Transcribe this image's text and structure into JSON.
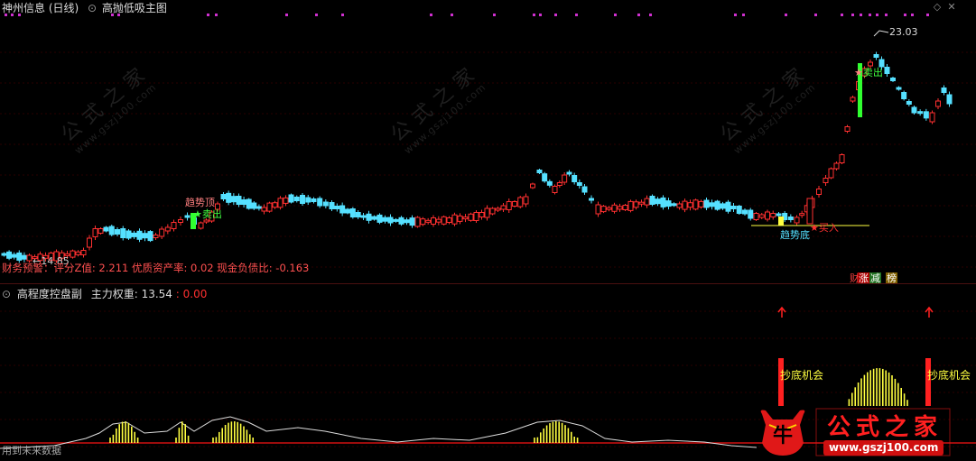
{
  "header": {
    "title": "神州信息 (日线)",
    "indicator_main": "高抛低吸主图",
    "window_controls": [
      "diamond-icon",
      "close-icon"
    ]
  },
  "main_chart": {
    "peak_price": "23.03",
    "labels": {
      "trend_top": "趋势顶",
      "sell": "卖出",
      "sell2": "卖出",
      "trend_bottom": "趋势底",
      "buy": "买入",
      "low_price": "14.85"
    },
    "info_line": "财务预警：评分Z值: 2.211 优质资产率: 0.02 现金负债比: -0.163",
    "badges": [
      "财",
      "涨",
      "减",
      "榜"
    ]
  },
  "sub_chart": {
    "title": "高程度控盘副",
    "weight_label": "主力权重: 13.54",
    "weight_change": ": 0.00",
    "opportunity_label_1": "抄底机会",
    "opportunity_label_2": "抄底机会",
    "footer_text": "用到未来数据"
  },
  "watermark": {
    "cn": "公式之家",
    "url": "www.gszj100.com"
  },
  "logo": {
    "text": "公式之家",
    "url": "www.gszj100.com",
    "mascot": "牛"
  },
  "colors": {
    "background": "#000000",
    "up": "#ff3030",
    "down": "#55e0ff",
    "divider": "#4a1010",
    "signal_dot": "#d030d0",
    "yellow": "#ffff40",
    "logo_red": "#e01818"
  }
}
